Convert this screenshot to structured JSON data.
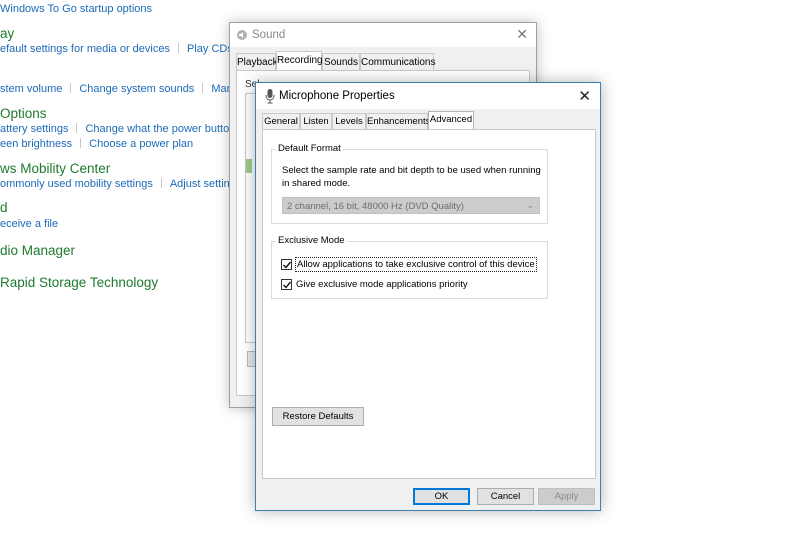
{
  "control_panel": {
    "rows": [
      {
        "heading": "",
        "links": [
          "Windows To Go startup options"
        ]
      },
      {
        "heading": "ay",
        "links": [
          "efault settings for media or devices",
          "Play CDs or"
        ]
      },
      {
        "heading": "",
        "links": [
          "stem volume",
          "Change system sounds",
          "Manage a"
        ]
      },
      {
        "heading": " Options",
        "links": [
          "attery settings",
          "Change what the power buttons d"
        ]
      },
      {
        "heading": "",
        "links": [
          "een brightness",
          "Choose a power plan"
        ]
      },
      {
        "heading": "ws Mobility Center",
        "links": [
          "ommonly used mobility settings",
          "Adjust settings be"
        ]
      },
      {
        "heading": "d",
        "links": [
          "eceive a file"
        ]
      },
      {
        "heading": "dio Manager",
        "links": []
      },
      {
        "heading": " Rapid Storage Technology",
        "links": []
      }
    ]
  },
  "sound_window": {
    "title": "Sound",
    "tabs": [
      "Playback",
      "Recording",
      "Sounds",
      "Communications"
    ],
    "active_tab": "Recording",
    "select_text": "Sel"
  },
  "dialog": {
    "title": "Microphone Properties",
    "tabs": [
      "General",
      "Listen",
      "Levels",
      "Enhancements",
      "Advanced"
    ],
    "active_tab": "Advanced",
    "default_format": {
      "label": "Default Format",
      "description": "Select the sample rate and bit depth to be used when running in shared mode.",
      "selected_value": "2 channel, 16 bit, 48000 Hz (DVD Quality)"
    },
    "exclusive_mode": {
      "label": "Exclusive Mode",
      "options": [
        {
          "label": "Allow applications to take exclusive control of this device",
          "checked": true
        },
        {
          "label": "Give exclusive mode applications priority",
          "checked": true
        }
      ]
    },
    "restore_defaults_label": "Restore Defaults",
    "ok_label": "OK",
    "cancel_label": "Cancel",
    "apply_label": "Apply"
  },
  "colors": {
    "heading_green": "#1e7a2e",
    "link_blue": "#1c6bb8",
    "dialog_border": "#3c7fb1",
    "default_button_blue": "#0078d7"
  }
}
